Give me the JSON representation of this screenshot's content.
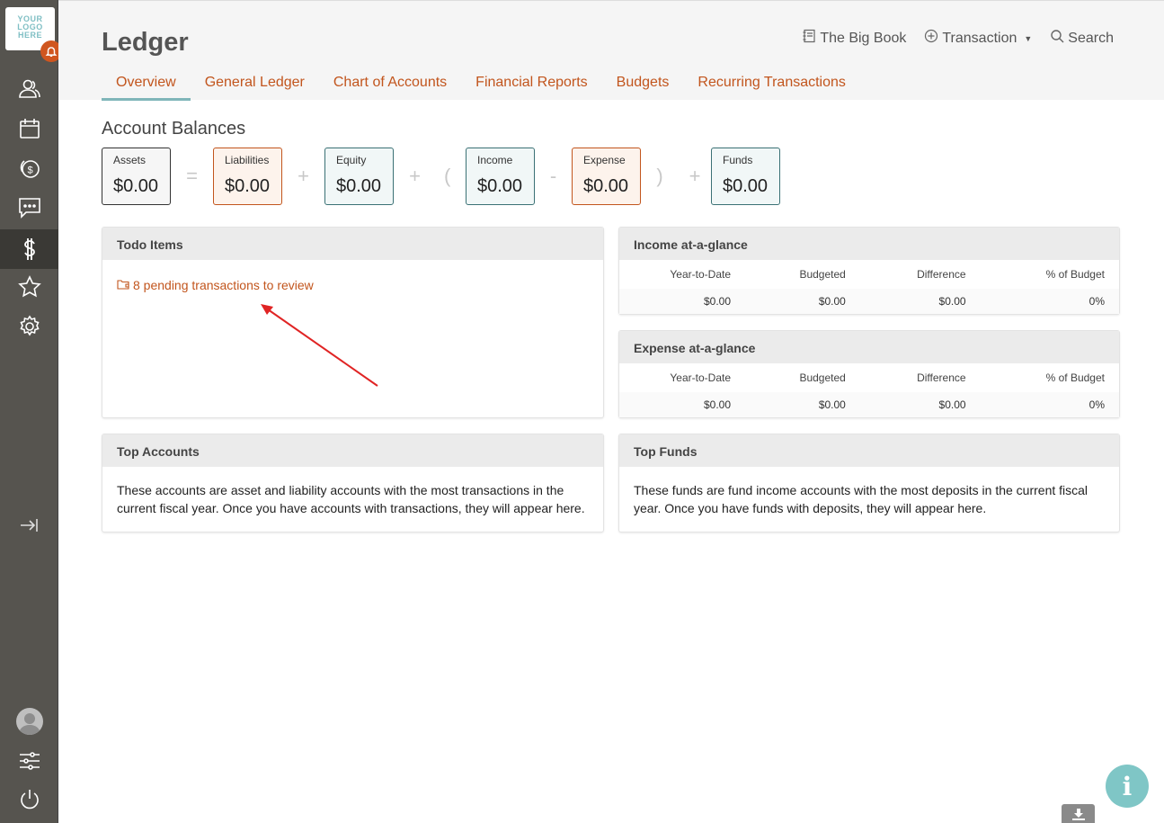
{
  "logo": {
    "text": "YOUR LOGO HERE"
  },
  "header": {
    "title": "Ledger",
    "actions": {
      "book": "The Big Book",
      "transaction": "Transaction",
      "search": "Search"
    },
    "tabs": [
      "Overview",
      "General Ledger",
      "Chart of Accounts",
      "Financial Reports",
      "Budgets",
      "Recurring Transactions"
    ]
  },
  "balances": {
    "title": "Account Balances",
    "items": [
      {
        "label": "Assets",
        "value": "$0.00"
      },
      {
        "label": "Liabilities",
        "value": "$0.00"
      },
      {
        "label": "Equity",
        "value": "$0.00"
      },
      {
        "label": "Income",
        "value": "$0.00"
      },
      {
        "label": "Expense",
        "value": "$0.00"
      },
      {
        "label": "Funds",
        "value": "$0.00"
      }
    ],
    "ops": [
      "=",
      "+",
      "+",
      "(",
      "-",
      ")",
      "+"
    ]
  },
  "todo": {
    "title": "Todo Items",
    "link": "8 pending transactions to review"
  },
  "income_glance": {
    "title": "Income at-a-glance",
    "columns": [
      "Year-to-Date",
      "Budgeted",
      "Difference",
      "% of Budget"
    ],
    "values": [
      "$0.00",
      "$0.00",
      "$0.00",
      "0%"
    ]
  },
  "expense_glance": {
    "title": "Expense at-a-glance",
    "columns": [
      "Year-to-Date",
      "Budgeted",
      "Difference",
      "% of Budget"
    ],
    "values": [
      "$0.00",
      "$0.00",
      "$0.00",
      "0%"
    ]
  },
  "top_accounts": {
    "title": "Top Accounts",
    "body": "These accounts are asset and liability accounts with the most transactions in the current fiscal year. Once you have accounts with transactions, they will appear here."
  },
  "top_funds": {
    "title": "Top Funds",
    "body": "These funds are fund income accounts with the most deposits in the current fiscal year. Once you have funds with deposits, they will appear here."
  },
  "colors": {
    "accent": "#c2551d",
    "sidebar": "#56544f",
    "teal": "#7fc6c6"
  },
  "icons": [
    "people-icon",
    "calendar-icon",
    "coins-icon",
    "chat-icon",
    "dollar-icon",
    "star-icon",
    "gear-icon",
    "collapse-icon",
    "sliders-icon",
    "power-icon",
    "info-icon",
    "download-icon",
    "bell-icon",
    "book-icon",
    "plus-circle-icon",
    "search-icon",
    "folder-icon"
  ]
}
